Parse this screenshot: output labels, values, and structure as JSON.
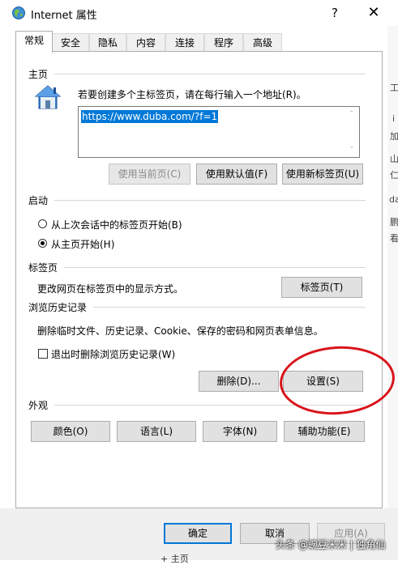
{
  "window": {
    "title": "Internet 属性",
    "help_glyph": "?",
    "close_glyph": "✕"
  },
  "tabs": [
    {
      "label": "常规",
      "active": true
    },
    {
      "label": "安全"
    },
    {
      "label": "隐私"
    },
    {
      "label": "内容"
    },
    {
      "label": "连接"
    },
    {
      "label": "程序"
    },
    {
      "label": "高级"
    }
  ],
  "homepage": {
    "section_title": "主页",
    "instruction": "若要创建多个主标签页，请在每行输入一个地址(R)。",
    "value": "https://www.duba.com/?f=1",
    "buttons": {
      "use_current": "使用当前页(C)",
      "use_default": "使用默认值(F)",
      "use_new_tab": "使用新标签页(U)"
    }
  },
  "startup": {
    "section_title": "启动",
    "option_last_session": "从上次会话中的标签页开始(B)",
    "option_home": "从主页开始(H)",
    "selected": "home"
  },
  "tab_settings": {
    "section_title": "标签页",
    "description": "更改网页在标签页中的显示方式。",
    "button": "标签页(T)"
  },
  "history": {
    "section_title": "浏览历史记录",
    "description": "删除临时文件、历史记录、Cookie、保存的密码和网页表单信息。",
    "checkbox_label": "退出时删除浏览历史记录(W)",
    "checked": false,
    "delete_button": "删除(D)...",
    "settings_button": "设置(S)"
  },
  "appearance": {
    "section_title": "外观",
    "colors": "颜色(O)",
    "languages": "语言(L)",
    "fonts": "字体(N)",
    "accessibility": "辅助功能(E)"
  },
  "footer": {
    "ok": "确定",
    "cancel": "取消",
    "apply": "应用(A)"
  },
  "watermark": "头条 @豌豆米米 | 独角仙",
  "background": {
    "glyphs": [
      "工",
      "i",
      "加",
      "山",
      "仁",
      "da",
      "鹏",
      "看"
    ],
    "bottom_peek": "+ 主页"
  },
  "colors": {
    "accent": "#0078d7",
    "annotation_circle": "#d9131a"
  }
}
